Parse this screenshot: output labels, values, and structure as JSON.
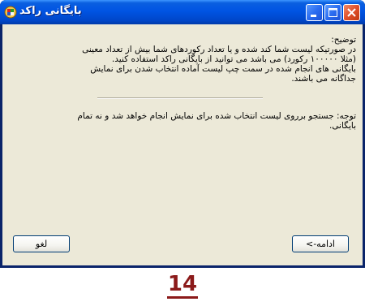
{
  "window": {
    "title": "بایگانی راکد",
    "icon": "app-icon"
  },
  "title_buttons": {
    "minimize": "minimize-icon",
    "maximize": "maximize-icon",
    "close": "close-icon"
  },
  "description": {
    "lines": [
      "توضیح:",
      "در صورتیکه لیست شما کند شده و یا تعداد رکوردهای شما بیش از تعداد معینی",
      "(مثلا ۱۰۰۰۰۰ رکورد) می باشد می توانید از بایگانی راکد استفاده کنید.",
      "بایگانی های انجام شده در سمت چپ لیست آماده انتخاب شدن برای نمایش",
      "جداگانه می باشند."
    ]
  },
  "note": {
    "lines": [
      "توجه: جستجو برروی لیست انتخاب شده برای نمایش انجام خواهد شد و نه تمام",
      "بایگانی."
    ]
  },
  "buttons": {
    "cancel_label": "لغو",
    "next_label": "ادامه->"
  },
  "page_number": "14"
}
